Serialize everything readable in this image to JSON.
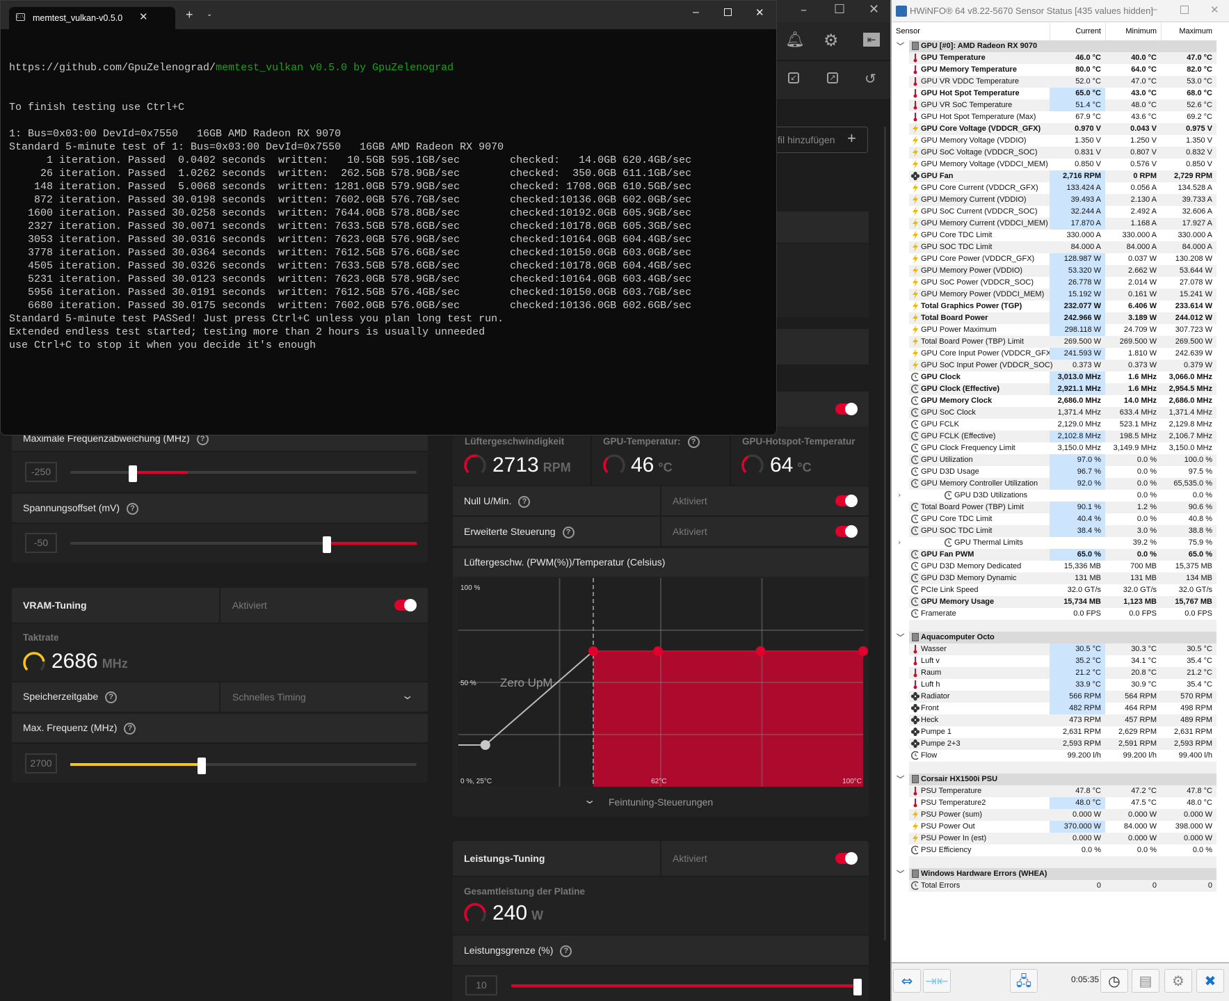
{
  "terminal": {
    "tab_title": "memtest_vulkan-v0.5.0",
    "url_prefix": "https://github.com/GpuZelenograd/",
    "url_green": "memtest_vulkan v0.5.0 by GpuZelenograd",
    "lines": [
      "To finish testing use Ctrl+C",
      "",
      "1: Bus=0x03:00 DevId=0x7550   16GB AMD Radeon RX 9070",
      "Standard 5-minute test of 1: Bus=0x03:00 DevId=0x7550   16GB AMD Radeon RX 9070",
      "      1 iteration. Passed  0.0402 seconds  written:   10.5GB 595.1GB/sec        checked:   14.0GB 620.4GB/sec",
      "     26 iteration. Passed  1.0262 seconds  written:  262.5GB 578.9GB/sec        checked:  350.0GB 611.1GB/sec",
      "    148 iteration. Passed  5.0068 seconds  written: 1281.0GB 579.9GB/sec        checked: 1708.0GB 610.5GB/sec",
      "    872 iteration. Passed 30.0198 seconds  written: 7602.0GB 576.7GB/sec        checked:10136.0GB 602.0GB/sec",
      "   1600 iteration. Passed 30.0258 seconds  written: 7644.0GB 578.8GB/sec        checked:10192.0GB 605.9GB/sec",
      "   2327 iteration. Passed 30.0071 seconds  written: 7633.5GB 578.6GB/sec        checked:10178.0GB 605.3GB/sec",
      "   3053 iteration. Passed 30.0316 seconds  written: 7623.0GB 576.9GB/sec        checked:10164.0GB 604.4GB/sec",
      "   3778 iteration. Passed 30.0364 seconds  written: 7612.5GB 576.6GB/sec        checked:10150.0GB 603.0GB/sec",
      "   4505 iteration. Passed 30.0326 seconds  written: 7633.5GB 578.6GB/sec        checked:10178.0GB 604.4GB/sec",
      "   5231 iteration. Passed 30.0123 seconds  written: 7623.0GB 578.9GB/sec        checked:10164.0GB 603.4GB/sec",
      "   5956 iteration. Passed 30.0191 seconds  written: 7612.5GB 576.4GB/sec        checked:10150.0GB 603.7GB/sec",
      "   6680 iteration. Passed 30.0175 seconds  written: 7602.0GB 576.0GB/sec        checked:10136.0GB 602.6GB/sec",
      "Standard 5-minute test PASSed! Just press Ctrl+C unless you plan long test run.",
      "Extended endless test started; testing more than 2 hours is usually unneeded",
      "use Ctrl+C to stop it when you decide it's enough"
    ]
  },
  "amd": {
    "add_profile_label": "fil hinzufügen",
    "max_freq_offset_label": "Maximale Frequenzabweichung (MHz)",
    "max_freq_offset_value": "-250",
    "max_freq_offset_slider": {
      "value": 0.18,
      "marker": 0.34
    },
    "voltage_offset_label": "Spannungsoffset (mV)",
    "voltage_offset_value": "-50",
    "voltage_offset_slider": 0.74,
    "vram": {
      "title": "VRAM-Tuning",
      "status": "Aktiviert",
      "clock_label": "Taktrate",
      "clock_value": "2686",
      "clock_unit": "MHz",
      "clock_gauge": 0.8,
      "timing_label": "Speicherzeitgabe",
      "timing_value": "Schnelles Timing",
      "max_freq_label": "Max. Frequenz (MHz)",
      "max_freq_value": "2700",
      "max_freq_slider": 0.38
    },
    "fan": {
      "speed_label": "Lüftergeschwindigkeit",
      "speed_value": "2713",
      "speed_unit": "RPM",
      "speed_gauge": 0.55,
      "gpu_temp_label": "GPU-Temperatur:",
      "gpu_temp_value": "46",
      "gpu_temp_unit": "°C",
      "gpu_temp_gauge": 0.35,
      "hotspot_label": "GPU-Hotspot-Temperatur",
      "hotspot_value": "64",
      "hotspot_unit": "°C",
      "hotspot_gauge": 0.4,
      "zero_rpm_label": "Null U/Min.",
      "zero_rpm_status": "Aktiviert",
      "advanced_label": "Erweiterte Steuerung",
      "advanced_status": "Aktiviert",
      "curve_title": "Lüftergeschw. (PWM(%))/Temperatur (Celsius)",
      "fine_tuning_label": "Feintuning-Steuerungen"
    },
    "fan_curve": {
      "type": "area",
      "x_range": [
        25,
        100
      ],
      "y_range": [
        0,
        100
      ],
      "zero_rpm_threshold": 50,
      "zero_rpm_label": "Zero UpM",
      "points": [
        [
          30,
          20
        ],
        [
          50,
          65
        ],
        [
          62,
          65
        ],
        [
          81,
          65
        ],
        [
          100,
          65
        ]
      ],
      "label_top": "100 %",
      "label_mid": "50 %",
      "label_origin": "0 %, 25°C",
      "label_x_mid": "62°C",
      "label_x_max": "100°C"
    },
    "power": {
      "title": "Leistungs-Tuning",
      "status": "Aktiviert",
      "board_power_label": "Gesamtleistung der Platine",
      "board_power_value": "240",
      "board_power_unit": "W",
      "board_power_gauge": 0.8,
      "limit_label": "Leistungsgrenze (%)",
      "limit_value": "10",
      "limit_slider": 1.0
    },
    "accent": "#e0002b",
    "vram_accent": "#f5c518"
  },
  "hwinfo": {
    "title": "HWiNFO® 64 v8.22-5670 Sensor Status [435 values hidden]",
    "columns": [
      "Sensor",
      "Current",
      "Minimum",
      "Maximum"
    ],
    "elapsed": "0:05:35",
    "rows": [
      {
        "grp": "GPU [#0]: AMD Radeon RX 9070"
      },
      {
        "i": "temp",
        "l": "GPU Temperature",
        "c": "46.0 °C",
        "mn": "40.0 °C",
        "mx": "47.0 °C",
        "b": 1
      },
      {
        "i": "temp",
        "l": "GPU Memory Temperature",
        "c": "80.0 °C",
        "mn": "64.0 °C",
        "mx": "82.0 °C",
        "b": 1
      },
      {
        "i": "temp",
        "l": "GPU VR VDDC Temperature",
        "c": "52.0 °C",
        "mn": "47.0 °C",
        "mx": "53.0 °C"
      },
      {
        "i": "temp",
        "l": "GPU Hot Spot Temperature",
        "c": "65.0 °C",
        "mn": "43.0 °C",
        "mx": "68.0 °C",
        "b": 1,
        "h": 1
      },
      {
        "i": "temp",
        "l": "GPU VR SoC Temperature",
        "c": "51.4 °C",
        "mn": "48.0 °C",
        "mx": "52.6 °C",
        "h": 1
      },
      {
        "i": "temp",
        "l": "GPU Hot Spot Temperature (Max)",
        "c": "67.9 °C",
        "mn": "43.6 °C",
        "mx": "69.2 °C"
      },
      {
        "i": "volt",
        "l": "GPU Core Voltage (VDDCR_GFX)",
        "c": "0.970 V",
        "mn": "0.043 V",
        "mx": "0.975 V",
        "b": 1
      },
      {
        "i": "volt",
        "l": "GPU Memory Voltage (VDDIO)",
        "c": "1.350 V",
        "mn": "1.250 V",
        "mx": "1.350 V"
      },
      {
        "i": "volt",
        "l": "GPU SoC Voltage (VDDCR_SOC)",
        "c": "0.831 V",
        "mn": "0.807 V",
        "mx": "0.832 V"
      },
      {
        "i": "volt",
        "l": "GPU Memory Voltage (VDDCI_MEM)",
        "c": "0.850 V",
        "mn": "0.576 V",
        "mx": "0.850 V"
      },
      {
        "i": "fan",
        "l": "GPU Fan",
        "c": "2,716 RPM",
        "mn": "0 RPM",
        "mx": "2,729 RPM",
        "b": 1,
        "h": 1
      },
      {
        "i": "volt",
        "l": "GPU Core Current (VDDCR_GFX)",
        "c": "133.424 A",
        "mn": "0.056 A",
        "mx": "134.528 A",
        "h": 1
      },
      {
        "i": "volt",
        "l": "GPU Memory Current (VDDIO)",
        "c": "39.493 A",
        "mn": "2.130 A",
        "mx": "39.733 A",
        "h": 1
      },
      {
        "i": "volt",
        "l": "GPU SoC Current (VDDCR_SOC)",
        "c": "32.244 A",
        "mn": "2.492 A",
        "mx": "32.606 A",
        "h": 1
      },
      {
        "i": "volt",
        "l": "GPU Memory Current (VDDCI_MEM)",
        "c": "17.870 A",
        "mn": "1.168 A",
        "mx": "17.927 A",
        "h": 1
      },
      {
        "i": "volt",
        "l": "GPU Core TDC Limit",
        "c": "330.000 A",
        "mn": "330.000 A",
        "mx": "330.000 A"
      },
      {
        "i": "volt",
        "l": "GPU SOC TDC Limit",
        "c": "84.000 A",
        "mn": "84.000 A",
        "mx": "84.000 A"
      },
      {
        "i": "volt",
        "l": "GPU Core Power (VDDCR_GFX)",
        "c": "128.987 W",
        "mn": "0.037 W",
        "mx": "130.208 W",
        "h": 1
      },
      {
        "i": "volt",
        "l": "GPU Memory Power (VDDIO)",
        "c": "53.320 W",
        "mn": "2.662 W",
        "mx": "53.644 W",
        "h": 1
      },
      {
        "i": "volt",
        "l": "GPU SoC Power (VDDCR_SOC)",
        "c": "26.778 W",
        "mn": "2.014 W",
        "mx": "27.078 W",
        "h": 1
      },
      {
        "i": "volt",
        "l": "GPU Memory Power (VDDCI_MEM)",
        "c": "15.192 W",
        "mn": "0.161 W",
        "mx": "15.241 W",
        "h": 1
      },
      {
        "i": "volt",
        "l": "Total Graphics Power (TGP)",
        "c": "232.077 W",
        "mn": "6.406 W",
        "mx": "233.614 W",
        "b": 1,
        "h": 1
      },
      {
        "i": "volt",
        "l": "Total Board Power",
        "c": "242.966 W",
        "mn": "3.189 W",
        "mx": "244.012 W",
        "b": 1,
        "h": 1
      },
      {
        "i": "volt",
        "l": "GPU Power Maximum",
        "c": "298.118 W",
        "mn": "24.709 W",
        "mx": "307.723 W",
        "h": 1
      },
      {
        "i": "volt",
        "l": "Total Board Power (TBP) Limit",
        "c": "269.500 W",
        "mn": "269.500 W",
        "mx": "269.500 W"
      },
      {
        "i": "volt",
        "l": "GPU Core Input Power (VDDCR_GFX)",
        "c": "241.593 W",
        "mn": "1.810 W",
        "mx": "242.639 W",
        "h": 1
      },
      {
        "i": "volt",
        "l": "GPU SoC Input Power (VDDCR_SOC)",
        "c": "0.373 W",
        "mn": "0.373 W",
        "mx": "0.379 W"
      },
      {
        "i": "clock",
        "l": "GPU Clock",
        "c": "3,013.0 MHz",
        "mn": "1.6 MHz",
        "mx": "3,066.0 MHz",
        "b": 1,
        "h": 1
      },
      {
        "i": "clock",
        "l": "GPU Clock (Effective)",
        "c": "2,921.1 MHz",
        "mn": "1.6 MHz",
        "mx": "2,954.5 MHz",
        "b": 1,
        "h": 1
      },
      {
        "i": "clock",
        "l": "GPU Memory Clock",
        "c": "2,686.0 MHz",
        "mn": "14.0 MHz",
        "mx": "2,686.0 MHz",
        "b": 1
      },
      {
        "i": "clock",
        "l": "GPU SoC Clock",
        "c": "1,371.4 MHz",
        "mn": "633.4 MHz",
        "mx": "1,371.4 MHz"
      },
      {
        "i": "clock",
        "l": "GPU FCLK",
        "c": "2,129.0 MHz",
        "mn": "523.1 MHz",
        "mx": "2,129.8 MHz"
      },
      {
        "i": "clock",
        "l": "GPU FCLK (Effective)",
        "c": "2,102.8 MHz",
        "mn": "198.5 MHz",
        "mx": "2,106.7 MHz",
        "h": 1
      },
      {
        "i": "clock",
        "l": "GPU Clock Frequency Limit",
        "c": "3,150.0 MHz",
        "mn": "3,149.9 MHz",
        "mx": "3,150.0 MHz"
      },
      {
        "i": "clock",
        "l": "GPU Utilization",
        "c": "97.0 %",
        "mn": "0.0 %",
        "mx": "100.0 %",
        "h": 1
      },
      {
        "i": "clock",
        "l": "GPU D3D Usage",
        "c": "96.7 %",
        "mn": "0.0 %",
        "mx": "97.5 %",
        "h": 1
      },
      {
        "i": "clock",
        "l": "GPU Memory Controller Utilization",
        "c": "92.0 %",
        "mn": "0.0 %",
        "mx": "65,535.0 %",
        "h": 1
      },
      {
        "i": "clock",
        "l": "GPU D3D Utilizations",
        "c": "",
        "mn": "0.0 %",
        "mx": "0.0 %",
        "sub": 1
      },
      {
        "i": "clock",
        "l": "Total Board Power (TBP) Limit",
        "c": "90.1 %",
        "mn": "1.2 %",
        "mx": "90.6 %",
        "h": 1
      },
      {
        "i": "clock",
        "l": "GPU Core TDC Limit",
        "c": "40.4 %",
        "mn": "0.0 %",
        "mx": "40.8 %",
        "h": 1
      },
      {
        "i": "clock",
        "l": "GPU SOC TDC Limit",
        "c": "38.4 %",
        "mn": "3.0 %",
        "mx": "38.8 %",
        "h": 1
      },
      {
        "i": "clock",
        "l": "GPU Thermal Limits",
        "c": "",
        "mn": "39.2 %",
        "mx": "75.9 %",
        "sub": 1
      },
      {
        "i": "clock",
        "l": "GPU Fan PWM",
        "c": "65.0 %",
        "mn": "0.0 %",
        "mx": "65.0 %",
        "b": 1,
        "h": 1
      },
      {
        "i": "clock",
        "l": "GPU D3D Memory Dedicated",
        "c": "15,336 MB",
        "mn": "700 MB",
        "mx": "15,375 MB"
      },
      {
        "i": "clock",
        "l": "GPU D3D Memory Dynamic",
        "c": "131 MB",
        "mn": "131 MB",
        "mx": "134 MB"
      },
      {
        "i": "clock",
        "l": "PCIe Link Speed",
        "c": "32.0 GT/s",
        "mn": "32.0 GT/s",
        "mx": "32.0 GT/s"
      },
      {
        "i": "clock",
        "l": "GPU Memory Usage",
        "c": "15,734 MB",
        "mn": "1,123 MB",
        "mx": "15,767 MB",
        "b": 1
      },
      {
        "i": "clock",
        "l": "Framerate",
        "c": "0.0 FPS",
        "mn": "0.0 FPS",
        "mx": "0.0 FPS"
      },
      {
        "blank": 1
      },
      {
        "grp": "Aquacomputer Octo"
      },
      {
        "i": "temp",
        "l": "Wasser",
        "c": "30.5 °C",
        "mn": "30.3 °C",
        "mx": "30.5 °C",
        "h": 1
      },
      {
        "i": "temp",
        "l": "Luft v",
        "c": "35.2 °C",
        "mn": "34.1 °C",
        "mx": "35.4 °C",
        "h": 1
      },
      {
        "i": "temp",
        "l": "Raum",
        "c": "21.2 °C",
        "mn": "20.8 °C",
        "mx": "21.2 °C",
        "h": 1
      },
      {
        "i": "temp",
        "l": "Luft h",
        "c": "33.9 °C",
        "mn": "30.9 °C",
        "mx": "35.4 °C",
        "h": 1
      },
      {
        "i": "fan",
        "l": "Radiator",
        "c": "566 RPM",
        "mn": "564 RPM",
        "mx": "570 RPM",
        "h": 1
      },
      {
        "i": "fan",
        "l": "Front",
        "c": "482 RPM",
        "mn": "464 RPM",
        "mx": "498 RPM",
        "h": 1
      },
      {
        "i": "fan",
        "l": "Heck",
        "c": "473 RPM",
        "mn": "457 RPM",
        "mx": "489 RPM"
      },
      {
        "i": "fan",
        "l": "Pumpe 1",
        "c": "2,631 RPM",
        "mn": "2,629 RPM",
        "mx": "2,631 RPM"
      },
      {
        "i": "fan",
        "l": "Pumpe 2+3",
        "c": "2,593 RPM",
        "mn": "2,591 RPM",
        "mx": "2,593 RPM"
      },
      {
        "i": "clock",
        "l": "Flow",
        "c": "99.200 l/h",
        "mn": "99.200 l/h",
        "mx": "99.400 l/h"
      },
      {
        "blank": 1
      },
      {
        "grp": "Corsair HX1500i PSU"
      },
      {
        "i": "temp",
        "l": "PSU Temperature",
        "c": "47.8 °C",
        "mn": "47.2 °C",
        "mx": "47.8 °C"
      },
      {
        "i": "temp",
        "l": "PSU Temperature2",
        "c": "48.0 °C",
        "mn": "47.5 °C",
        "mx": "48.0 °C",
        "h": 1
      },
      {
        "i": "volt",
        "l": "PSU Power (sum)",
        "c": "0.000 W",
        "mn": "0.000 W",
        "mx": "0.000 W"
      },
      {
        "i": "volt",
        "l": "PSU Power Out",
        "c": "370.000 W",
        "mn": "84.000 W",
        "mx": "398.000 W",
        "h": 1
      },
      {
        "i": "volt",
        "l": "PSU Power In (est)",
        "c": "0.000 W",
        "mn": "0.000 W",
        "mx": "0.000 W"
      },
      {
        "i": "clock",
        "l": "PSU Efficiency",
        "c": "0.0 %",
        "mn": "0.0 %",
        "mx": "0.0 %"
      },
      {
        "blank": 1
      },
      {
        "grp": "Windows Hardware Errors (WHEA)"
      },
      {
        "i": "clock",
        "l": "Total Errors",
        "c": "0",
        "mn": "0",
        "mx": "0"
      }
    ]
  }
}
